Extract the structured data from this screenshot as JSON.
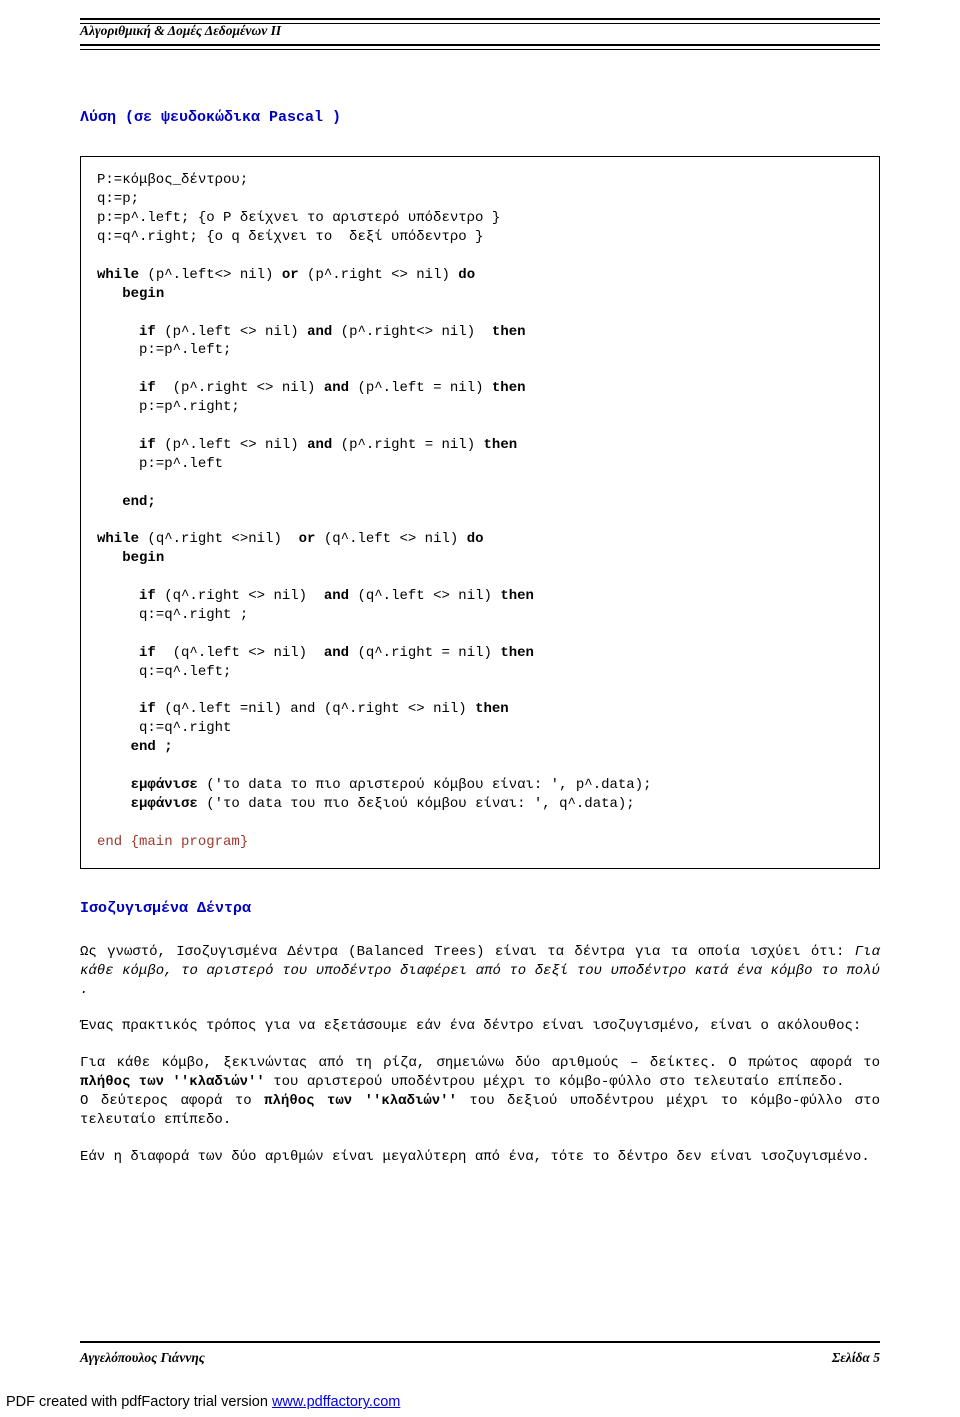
{
  "header": {
    "title": "Αλγοριθμική & Δομές Δεδομένων ΙΙ"
  },
  "section": {
    "title": "Λύση (σε ψευδοκώδικα Pascal )",
    "code": "P:=κόμβος_δέντρου;\nq:=p;\np:=p^.left; {ο P δείχνει το αριστερό υπόδεντρο }\nq:=q^.right; {ο q δείχνει το  δεξί υπόδεντρο }\n\n<b>while</b> (p^.left<> nil) <b>or</b> (p^.right <> nil) <b>do</b>\n   <b>begin</b>\n\n     <b>if</b> (p^.left <> nil) <b>and</b> (p^.right<> nil)  <b>then</b>\n     p:=p^.left;\n\n     <b>if</b>  (p^.right <> nil) <b>and</b> (p^.left = nil) <b>then</b>\n     p:=p^.right;\n\n     <b>if</b> (p^.left <> nil) <b>and</b> (p^.right = nil) <b>then</b>\n     p:=p^.left\n\n   <b>end;</b>\n\n<b>while</b> (q^.right <>nil)  <b>or</b> (q^.left <> nil) <b>do</b>\n   <b>begin</b>\n\n     <b>if</b> (q^.right <> nil)  <b>and</b> (q^.left <> nil) <b>then</b>\n     q:=q^.right ;\n\n     <b>if</b>  (q^.left <> nil)  <b>and</b> (q^.right = nil) <b>then</b>\n     q:=q^.left;\n\n     <b>if</b> (q^.left =nil) and (q^.right <> nil) <b>then</b>\n     q:=q^.right\n    <b>end ;</b>\n\n    <b>εμφάνισε</b> ('το data το πιο αριστερού κόμβου είναι: ', p^.data);\n    <b>εμφάνισε</b> ('το data του πιο δεξιού κόμβου είναι: ', q^.data);\n\n<span class=\"prg\">end {main program}</span>"
  },
  "balanced": {
    "heading": "Ισοζυγισμένα Δέντρα",
    "p1a": "Ως γνωστό, Ισοζυγισμένα Δέντρα (Balanced Trees) είναι τα δέντρα για τα οποία ισχύει ότι: ",
    "p1b": "Για κάθε κόμβο,  το αριστερό του υποδέντρο διαφέρει από το δεξί του υποδέντρο κατά ένα κόμβο το πολύ .",
    "p2": "Ένας πρακτικός τρόπος για να εξετάσουμε εάν ένα δέντρο είναι ισοζυγισμένο, είναι ο ακόλουθος:",
    "p3a": "Για κάθε κόμβο, ξεκινώντας από τη ρίζα, σημειώνω  δύο αριθμούς – δείκτες. Ο πρώτος αφορά το ",
    "p3b": "πλήθος των ''κλαδιών''",
    "p3c": " του αριστερού υποδέντρου μέχρι το κόμβο-φύλλο στο τελευταίο επίπεδο.",
    "p4a": "Ο δεύτερος αφορά το ",
    "p4b": "πλήθος των ''κλαδιών''",
    "p4c": " του δεξιού υποδέντρου μέχρι το κόμβο-φύλλο στο τελευταίο επίπεδο.",
    "p5": "Εάν η διαφορά των δύο αριθμών είναι μεγαλύτερη από ένα,  τότε το δέντρο δεν είναι ισοζυγισμένο."
  },
  "footer": {
    "author": "Αγγελόπουλος Γιάννης",
    "page": "Σελίδα 5"
  },
  "pdfnote": {
    "text": "PDF created with pdfFactory trial version ",
    "link": "www.pdffactory.com"
  }
}
